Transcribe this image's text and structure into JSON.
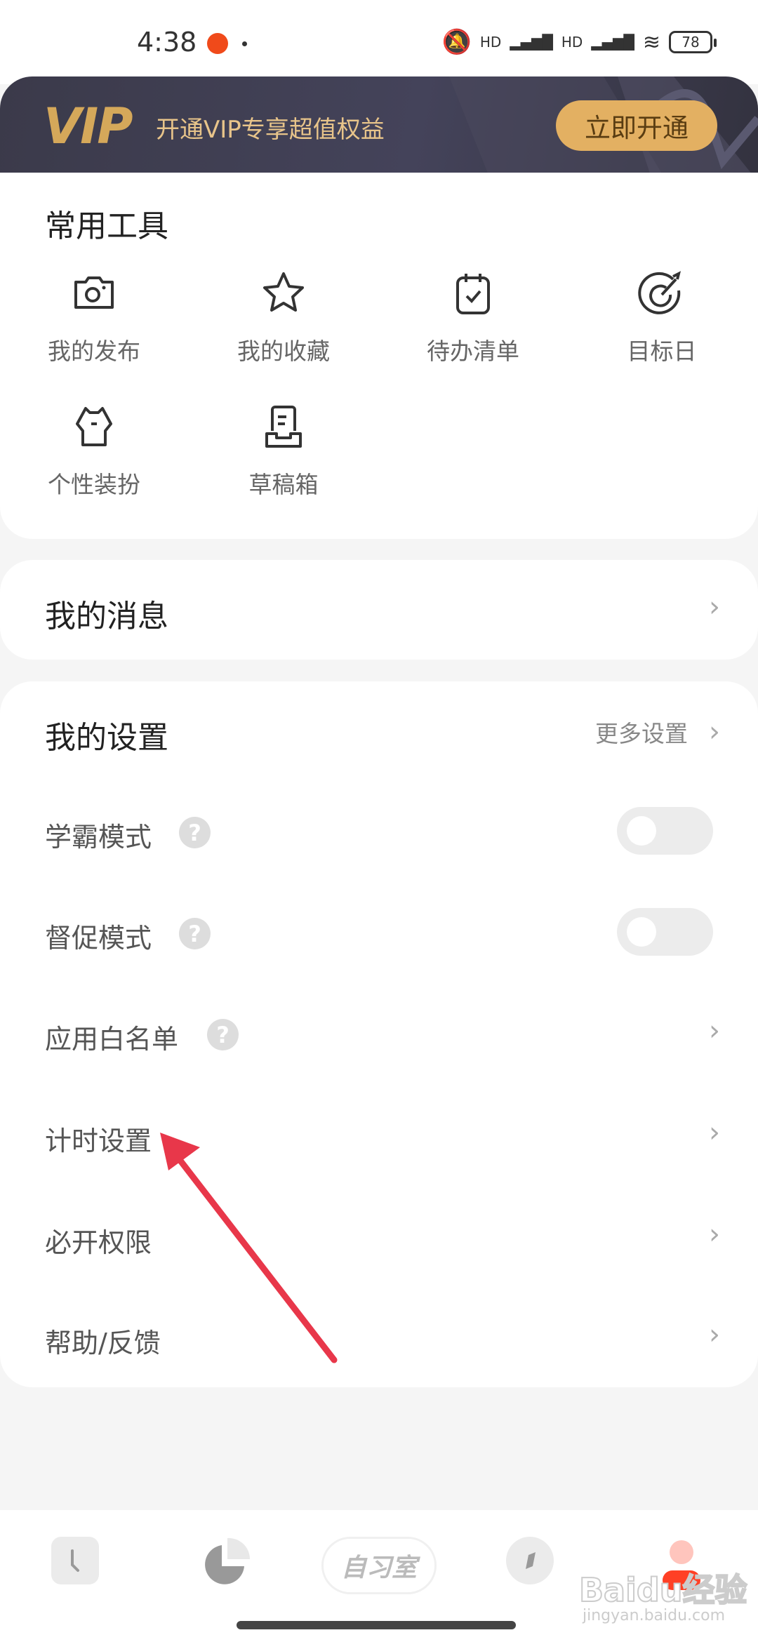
{
  "status_bar": {
    "time": "4:38",
    "battery": "78",
    "signal_label": "HD"
  },
  "vip_banner": {
    "logo": "VIP",
    "text": "开通VIP专享超值权益",
    "button": "立即开通",
    "accent": "#e3b062"
  },
  "tools": {
    "title": "常用工具",
    "items": [
      {
        "label": "我的发布",
        "icon": "camera-icon"
      },
      {
        "label": "我的收藏",
        "icon": "star-icon"
      },
      {
        "label": "待办清单",
        "icon": "calendar-check-icon"
      },
      {
        "label": "目标日",
        "icon": "target-icon"
      },
      {
        "label": "个性装扮",
        "icon": "shirt-icon"
      },
      {
        "label": "草稿箱",
        "icon": "draft-box-icon"
      }
    ]
  },
  "messages": {
    "title": "我的消息"
  },
  "settings": {
    "title": "我的设置",
    "more": "更多设置",
    "rows": [
      {
        "label": "学霸模式",
        "help": "?",
        "toggle": false
      },
      {
        "label": "督促模式",
        "help": "?",
        "toggle": false
      },
      {
        "label": "应用白名单",
        "help": "?"
      },
      {
        "label": "计时设置"
      },
      {
        "label": "必开权限"
      },
      {
        "label": "帮助/反馈"
      }
    ]
  },
  "bottom_nav": {
    "items": [
      {
        "icon": "clock-icon"
      },
      {
        "icon": "pie-chart-icon"
      },
      {
        "label": "自习室"
      },
      {
        "icon": "compass-icon"
      },
      {
        "icon": "profile-icon"
      }
    ]
  },
  "watermark": {
    "text": "Baidu经验",
    "url": "jingyan.baidu.com"
  },
  "annotation": {
    "color": "#e8374a"
  }
}
